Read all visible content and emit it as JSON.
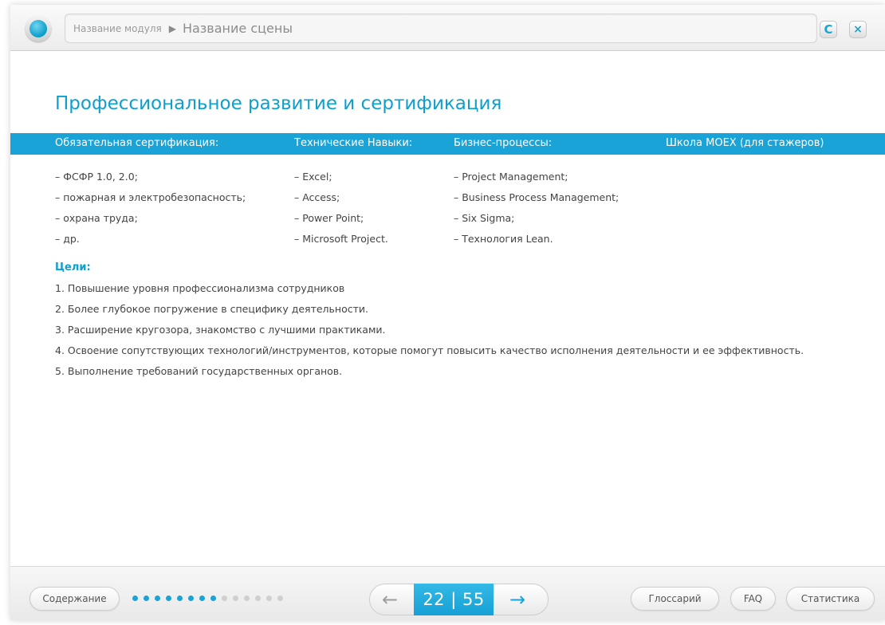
{
  "header": {
    "module_name": "Название модуля",
    "separator": "▶",
    "scene_name": "Название сцены",
    "refresh_symbol": "C",
    "close_symbol": "×"
  },
  "title": "Профессиональное развитие и сертификация",
  "columns": [
    {
      "heading": "Обязательная сертификация:",
      "note": "",
      "items": [
        "– ФСФР 1.0, 2.0;",
        "– пожарная и электробезопасность;",
        "– охрана труда;",
        "– др."
      ]
    },
    {
      "heading": "Технические Навыки:",
      "note": "",
      "items": [
        "– Excel;",
        "– Access;",
        "– Power Point;",
        "– Microsoft Project."
      ]
    },
    {
      "heading": "Бизнес-процессы:",
      "note": "",
      "items": [
        "– Project Management;",
        "– Business Process Management;",
        "– Six Sigma;",
        "– Технология Lean."
      ]
    },
    {
      "heading": "Школа МОЕХ",
      "note": "(для стажеров)",
      "items": []
    }
  ],
  "goals": {
    "title": "Цели:",
    "items": [
      "1. Повышение уровня профессионализма сотрудников",
      "2. Более глубокое погружение в специфику деятельности.",
      "3. Расширение кругозора, знакомство с лучшими практиками.",
      "4. Освоение сопутствующих технологий/инструментов, которые помогут повысить качество исполнения деятельности и ее эффективность.",
      "5. Выполнение требований государственных органов."
    ]
  },
  "footer": {
    "contents_label": "Содержание",
    "progress": {
      "completed": 8,
      "total": 14
    },
    "counter": "22 | 55",
    "prev_symbol": "←",
    "next_symbol": "→",
    "glossary_label": "Глоссарий",
    "faq_label": "FAQ",
    "stats_label": "Статистика"
  },
  "colors": {
    "accent": "#1aa3d6",
    "title": "#0d9fce",
    "dot_inactive": "#cfcfcf"
  }
}
